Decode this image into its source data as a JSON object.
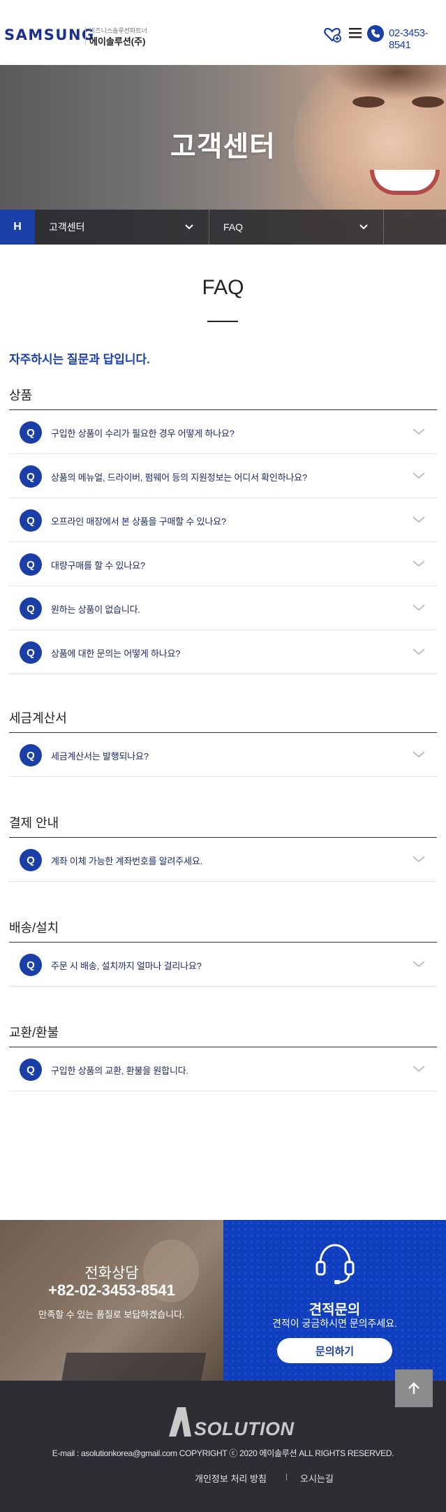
{
  "header": {
    "logo": "SAMSUNG",
    "partner_text": "비즈니스솔루션파트너",
    "company": "에이솔루션(주)",
    "phone": "02-3453-8541"
  },
  "hero": {
    "title": "고객센터",
    "home_label": "H",
    "dropdown1": "고객센터",
    "dropdown2": "FAQ"
  },
  "main": {
    "page_title": "FAQ",
    "intro": "자주하시는 질문과 답입니다.",
    "q_badge": "Q",
    "categories": [
      {
        "title": "상품",
        "questions": [
          "구입한 상품이 수리가 필요한 경우 어떻게 하나요?",
          "상품의 메뉴얼, 드라이버, 펌웨어 등의 지원정보는 어디서 확인하나요?",
          "오프라인 매장에서 본 상품을 구매할 수 있나요?",
          "대량구매를 할 수 있나요?",
          "원하는 상품이 없습니다.",
          "상품에 대한 문의는 어떻게 하나요?"
        ]
      },
      {
        "title": "세금계산서",
        "questions": [
          "세금계산서는 발행되나요?"
        ]
      },
      {
        "title": "결제 안내",
        "questions": [
          "계좌 이체 가능한 계좌번호를 알려주세요."
        ]
      },
      {
        "title": "배송/설치",
        "questions": [
          "주문 시 배송, 설치까지 얼마나 걸리나요?"
        ]
      },
      {
        "title": "교환/환불",
        "questions": [
          "구입한 상품의 교환, 환불을 원합니다."
        ]
      }
    ]
  },
  "banner_left": {
    "title": "전화상담",
    "phone": "+82-02-3453-8541",
    "desc": "만족할 수 있는 품질로 보답하겠습니다."
  },
  "banner_right": {
    "title": "견적문의",
    "desc": "견적이 궁금하시면 문의주세요.",
    "button": "문의하기"
  },
  "footer": {
    "logo_text": "SOLUTION",
    "copyright": "E-mail : asolutionkorea@gmail.com COPYRIGHT ⓒ 2020 에이솔루션 ALL RIGHTS RESERVED.",
    "link1": "개인정보 처리 방침",
    "link2": "오시는길"
  },
  "colors": {
    "brand_blue": "#1a3fa6",
    "footer_bg": "#2c2e33"
  }
}
